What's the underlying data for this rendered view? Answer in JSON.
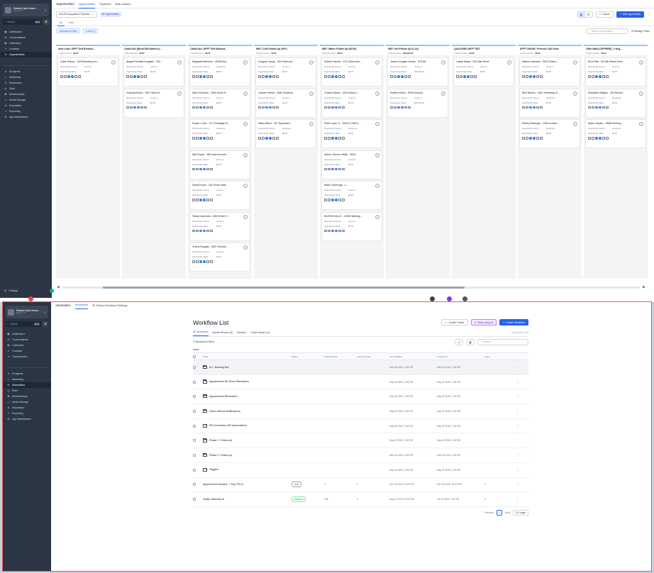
{
  "sidebar": {
    "account_name": "Fastest Cash Home…",
    "account_location": "Albany, NY",
    "search_placeholder": "Search",
    "search_shortcut": "ctrl K",
    "items": [
      {
        "label": "Dashboard",
        "icon": "dashboard-icon",
        "group": 1
      },
      {
        "label": "Conversations",
        "icon": "chat-icon",
        "group": 1
      },
      {
        "label": "Calendars",
        "icon": "calendar-icon",
        "group": 1
      },
      {
        "label": "Contacts",
        "icon": "contacts-icon",
        "group": 1
      },
      {
        "label": "Opportunities",
        "icon": "funnel-icon",
        "group": 1
      },
      {
        "label": "AI Agents",
        "icon": "sparkle-icon",
        "group": 2
      },
      {
        "label": "Marketing",
        "icon": "megaphone-icon",
        "group": 2
      },
      {
        "label": "Automation",
        "icon": "automation-icon",
        "group": 2
      },
      {
        "label": "Sites",
        "icon": "globe-icon",
        "group": 2
      },
      {
        "label": "Memberships",
        "icon": "badge-icon",
        "group": 2
      },
      {
        "label": "Media Storage",
        "icon": "folder-icon",
        "group": 2
      },
      {
        "label": "Reputation",
        "icon": "star-icon",
        "group": 2
      },
      {
        "label": "Reporting",
        "icon": "chart-icon",
        "group": 2
      },
      {
        "label": "App Marketplace",
        "icon": "grid-icon",
        "group": 2
      }
    ],
    "settings_label": "Settings"
  },
  "top": {
    "header_title": "Opportunities",
    "tabs": [
      "Opportunities",
      "Pipelines",
      "Bulk Actions"
    ],
    "active_tab": 0,
    "pipeline_select": "SALES Acquisition Pipeline",
    "count_chip": "83 Opportunities",
    "import_label": "Import",
    "add_label": "Add opportunity",
    "subtabs": [
      "All",
      "+ Add"
    ],
    "advanced_filters": "Advanced Filters",
    "sort_label": "Sort (1)",
    "search_placeholder": "Search Opportunities",
    "manage_fields": "Manage Fields",
    "columns": [
      {
        "name": "New Lead: APPT Self Booked…",
        "meta": "1 Opportunities",
        "value": "$0.00",
        "cards": [
          {
            "t": "Carla Sharon - 433 Branding Iron…",
            "src": "survey 1",
            "val": "$0.00"
          }
        ]
      },
      {
        "name": "Called-NA (Rural 5D/Called>x)…",
        "meta": "2 Opportunities",
        "value": "$0.00",
        "cards": [
          {
            "t": "Abigail Kendall-Douglass - 910…",
            "src": "survey 1",
            "val": "$0.00"
          },
          {
            "t": "Yolanda Brown - 3927 West M…",
            "src": "survey 1",
            "val": "$0.00"
          }
        ]
      },
      {
        "name": "Called-NA: APPT Self Booked…",
        "meta": "7 Opportunities",
        "value": "$0.00",
        "cards": [
          {
            "t": "Margarita Ramirez - 40030 Ave…",
            "src": "Facebook",
            "val": "$0.00"
          },
          {
            "t": "Dam D'Andrea - 23a0 South H…",
            "src": "survey 1",
            "val": "$0.00"
          },
          {
            "t": "Susan L Carr - 217 Kentridge Hi…",
            "src": "Facebook",
            "val": "$0.00"
          },
          {
            "t": "Nell Dupas - 189 union st mele…",
            "src": "survey 1",
            "val": "$0.00"
          },
          {
            "t": "Darrell Nuan - 152 South madi…",
            "src": "survey 1",
            "val": "$0.00"
          },
          {
            "t": "Teshia Summers - 558 W Bell S…",
            "src": "survey 1",
            "val": "$0.00"
          },
          {
            "t": "Cheryl Faugate - 8307 Woodst…",
            "src": "survey 1",
            "val": "$0.00"
          }
        ]
      },
      {
        "name": "NBT: Cold Follow Up (90+)",
        "meta": "3 Opportunities",
        "value": "$0.00",
        "cards": [
          {
            "t": "Gregory Young - 150 Fairbrook…",
            "src": "survey 1",
            "val": "$0.00"
          },
          {
            "t": "Joanne Fenton - 6081 Southwe…",
            "src": "survey 1",
            "val": "$0.00"
          },
          {
            "t": "Hilary Alford - 427 Sycamore…",
            "src": "Facebook",
            "val": "$0.00"
          }
        ]
      },
      {
        "name": "NBT: Warm Follow Up (30-90)",
        "meta": "6 Opportunities",
        "value": "$0.00",
        "cards": [
          {
            "t": "Delbert Farmer - 1271 Memorial…",
            "src": "survey 1",
            "val": "$0.00"
          },
          {
            "t": "Charles Myers - 326 Jockey C…",
            "src": "survey 1",
            "val": "$0.00"
          },
          {
            "t": "Pedro Lape Jr. - 5000 S 236Th…",
            "src": "Facebook",
            "val": "$0.00"
          },
          {
            "t": "Adrion Clemon-White - 4020…",
            "src": "survey 1",
            "val": "$0.00"
          },
          {
            "t": "Keith Cummings - 1…",
            "src": "survey 1",
            "val": "$0.00"
          },
          {
            "t": "EILEEN HALLE - 10005 Wellingt…",
            "src": "survey 1",
            "val": "$0.00"
          }
        ]
      },
      {
        "name": "NBT: Hot Follow Up (1-14)",
        "meta": "2 Opportunities",
        "value": "$30,000.00",
        "cards": [
          {
            "t": "James Douglas Henley - 376 Wi…",
            "src": "survey 1",
            "val": "$30,000.00"
          },
          {
            "t": "Robbie Keese - 8763 Autumn…",
            "src": "survey 1",
            "val": "$30,000.00"
          }
        ]
      },
      {
        "name": "QUALIFIED APPT SET",
        "meta": "1 Opportunities",
        "value": "$0.00",
        "cards": [
          {
            "t": "Latrita Hadja - 153 Oak Street",
            "src": "survey 1",
            "val": "$0.00"
          }
        ]
      },
      {
        "name": "APPT SHOW / Process Call Done",
        "meta": "4 Opportunities",
        "value": "$0.00",
        "cards": [
          {
            "t": "Sabrina Narvaez - 3523 Rosen…",
            "src": "survey 1",
            "val": "$0.00"
          },
          {
            "t": "Rick Nelson - 4622 Timberbay D…",
            "src": "Facebook",
            "val": "$0.00"
          },
          {
            "t": "Shirley Reamger - 1300 w main…",
            "src": "Facebook",
            "val": "$0.00"
          }
        ]
      },
      {
        "name": "Offer Made [OFFMRE] -> Neg…",
        "meta": "5 Opportunities",
        "value": "$0.00",
        "cards": [
          {
            "t": "Errol Ellis - 39 Oak Street Drive",
            "src": "survey 1",
            "val": "$0.00"
          },
          {
            "t": "Reynaldo Villegas - 150 Reconl…",
            "src": "Facebook",
            "val": "$0.00"
          },
          {
            "t": "Diane Jacobs - 23653 Hickory…",
            "src": "Facebook",
            "val": "$0.00"
          }
        ]
      }
    ],
    "card_labels": {
      "source": "Opportunity Source",
      "value": "Opportunity Value"
    }
  },
  "bottom": {
    "header_title": "Automation",
    "tabs": [
      "Workflows",
      "Global Workflow Settings"
    ],
    "active_tab": 0,
    "page_title": "Workflow List",
    "create_folder": "Create Folder",
    "build_ai": "Build using AI",
    "create_workflow": "Create Workflow",
    "list_tabs": [
      "All Workflows",
      "Needs Review (0)",
      "Deleted",
      "+ New Smart List"
    ],
    "list_tabs_right": "Customize List",
    "advanced_filters": "Advanced Filters",
    "search_placeholder": "Search",
    "name_label": "Name",
    "columns": [
      "Name",
      "Status",
      "Total Enrolled",
      "Active Enrolled",
      "Last Updated",
      "Created On",
      "Index"
    ],
    "rows": [
      {
        "name": "A.L. Booking Bot",
        "folder": true,
        "status": "",
        "total": "",
        "active": "",
        "updated": "May 28 2025, 2:36 PM",
        "created": "May 28 2025, 2:36 PM",
        "idx": ""
      },
      {
        "name": "Appointment No Show Reminders",
        "folder": true,
        "status": "",
        "total": "",
        "active": "",
        "updated": "May 28 2025, 2:36 PM",
        "created": "May 28 2025, 2:36 PM",
        "idx": ""
      },
      {
        "name": "Appointment Reminders",
        "folder": true,
        "status": "",
        "total": "",
        "active": "",
        "updated": "May 28 2025, 2:36 PM",
        "created": "May 28 2025, 2:36 PM",
        "idx": ""
      },
      {
        "name": "Client Internal Notifications",
        "folder": true,
        "status": "",
        "total": "",
        "active": "",
        "updated": "May 28 2025, 2:36 PM",
        "created": "May 28 2025, 2:36 PM",
        "idx": ""
      },
      {
        "name": "FB Conversion API Automations",
        "folder": true,
        "status": "",
        "total": "",
        "active": "",
        "updated": "May 28 2025, 2:36 PM",
        "created": "May 28 2025, 2:36 PM",
        "idx": ""
      },
      {
        "name": "Phase 1: Follow-Up",
        "folder": true,
        "status": "",
        "total": "",
        "active": "",
        "updated": "May 28 2025, 2:36 PM",
        "created": "May 28 2025, 2:36 PM",
        "idx": ""
      },
      {
        "name": "Phase 2: Follow-Up",
        "folder": true,
        "status": "",
        "total": "",
        "active": "",
        "updated": "May 28 2025, 2:36 PM",
        "created": "May 28 2025, 2:36 PM",
        "idx": ""
      },
      {
        "name": "Triggers",
        "folder": true,
        "status": "",
        "total": "",
        "active": "",
        "updated": "May 28 2025, 2:36 PM",
        "created": "May 28 2025, 2:36 PM",
        "idx": ""
      },
      {
        "name": "Appointment Booked -> Pay 375",
        "folder": false,
        "status": "Draft",
        "total": "0",
        "active": "0",
        "updated": "Dec 08 2025, 10:00 PM",
        "created": "Dec 08 2025, 10:00 PM",
        "idx": "3"
      },
      {
        "name": "Notify: Warranty",
        "folder": false,
        "status": "Published",
        "total": "136",
        "active": "0",
        "updated": "Aug 21 2025, 10:04 PM",
        "created": "Jul 25 2025, 2:34 PM",
        "idx": "3"
      }
    ],
    "prev_label": "Previous",
    "current_page": "1",
    "next_label": "Next",
    "per_page": "10 / page"
  }
}
